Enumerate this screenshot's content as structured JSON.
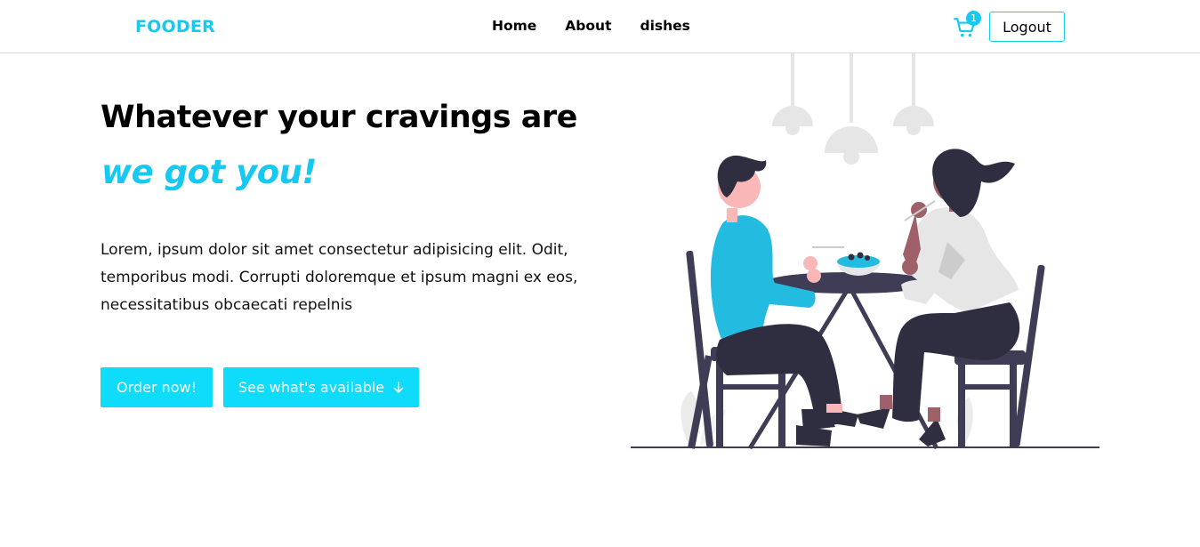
{
  "nav": {
    "logo": "FOODER",
    "links": [
      "Home",
      "About",
      "dishes"
    ],
    "cart_count": "1",
    "logout_label": "Logout"
  },
  "hero": {
    "headline": "Whatever your cravings are",
    "tagline": "we got you!",
    "description": "Lorem, ipsum dolor sit amet consectetur adipisicing elit. Odit, temporibus modi. Corrupti doloremque et ipsum magni ex eos, necessitatibus obcaecati repelnis",
    "order_button": "Order now!",
    "available_button": "See what's available"
  },
  "colors": {
    "accent": "#17c9f0",
    "button": "#0fdbfa",
    "dark": "#2f2e41",
    "shirt": "#23bbe0"
  },
  "icons": {
    "cart": "cart-icon",
    "arrow": "arrow-down-icon"
  }
}
